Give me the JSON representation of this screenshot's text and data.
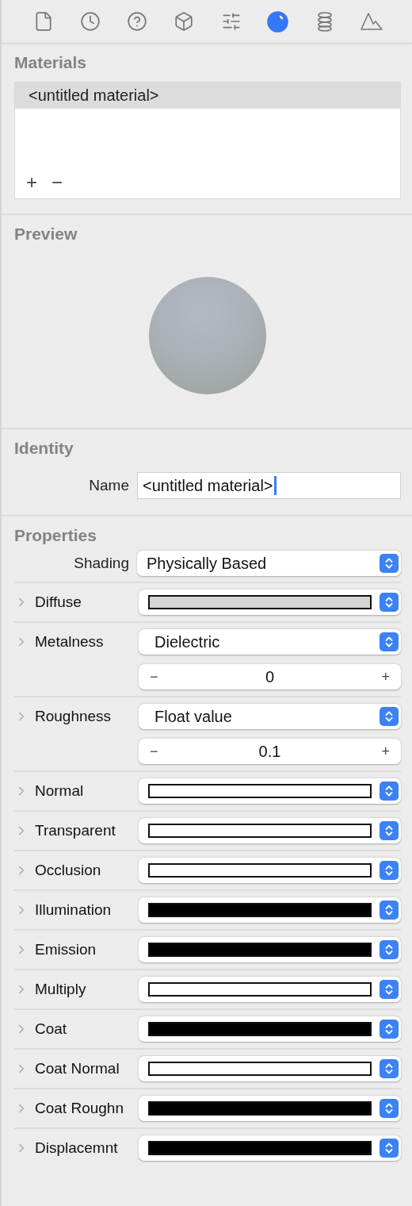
{
  "toolbar": {
    "tabs": [
      {
        "selected": false
      },
      {
        "selected": false
      },
      {
        "selected": false
      },
      {
        "selected": false
      },
      {
        "selected": false
      },
      {
        "selected": true
      },
      {
        "selected": false
      },
      {
        "selected": false
      }
    ]
  },
  "materials": {
    "title": "Materials",
    "items": [
      {
        "name": "<untitled material>",
        "selected": true
      }
    ],
    "add_button": "+",
    "remove_button": "−"
  },
  "preview": {
    "title": "Preview"
  },
  "identity": {
    "title": "Identity",
    "name_label": "Name",
    "name_value": "<untitled material>",
    "focused": true
  },
  "properties": {
    "title": "Properties",
    "rows": [
      {
        "kind": "select",
        "label": "Shading",
        "value": "Physically Based"
      },
      {
        "kind": "color",
        "label": "Diffuse",
        "color": "#d4d4d4"
      },
      {
        "kind": "mode",
        "label": "Metalness",
        "value": "Dielectric",
        "number": "0",
        "minus": "−",
        "plus": "+"
      },
      {
        "kind": "mode",
        "label": "Roughness",
        "value": "Float value",
        "number": "0.1",
        "minus": "−",
        "plus": "+"
      },
      {
        "kind": "color",
        "label": "Normal",
        "color": "#ffffff"
      },
      {
        "kind": "color",
        "label": "Transparent",
        "color": "#ffffff"
      },
      {
        "kind": "color",
        "label": "Occlusion",
        "color": "#ffffff"
      },
      {
        "kind": "color",
        "label": "Illumination",
        "color": "#000000"
      },
      {
        "kind": "color",
        "label": "Emission",
        "color": "#000000"
      },
      {
        "kind": "color",
        "label": "Multiply",
        "color": "#ffffff"
      },
      {
        "kind": "color",
        "label": "Coat",
        "color": "#000000"
      },
      {
        "kind": "color",
        "label": "Coat Normal",
        "color": "#ffffff"
      },
      {
        "kind": "color",
        "label": "Coat Roughn",
        "color": "#000000"
      },
      {
        "kind": "color",
        "label": "Displacemnt",
        "color": "#000000"
      }
    ]
  }
}
